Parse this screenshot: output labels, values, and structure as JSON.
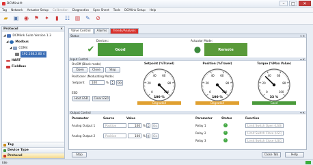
{
  "window": {
    "title": "DCMlink®",
    "min": "–",
    "max": "□",
    "close": "✕"
  },
  "menu": [
    "Tag",
    "Network",
    "Actuator Setup",
    "Calibration",
    "Diagnostics",
    "Spec Sheet",
    "Tools",
    "DCMlink Setup",
    "Help"
  ],
  "toolbar_icons": [
    "folder-icon",
    "device-icon",
    "network-icon",
    "flag-icon",
    "wizard-icon",
    "calibrate-icon",
    "checklist-icon",
    "chart-icon",
    "edit-icon",
    "help-icon"
  ],
  "sidebar": {
    "title": "Protocol",
    "close": "×",
    "tree": [
      {
        "label": "DCMlink Suite Version 1.3"
      },
      {
        "label": "Modbus"
      },
      {
        "label": "COM4"
      },
      {
        "label": "192.168.2.80 4"
      },
      {
        "label": "HART"
      },
      {
        "label": "Fieldbus"
      }
    ],
    "nav": [
      {
        "label": "Tag",
        "color": "#c98a1b"
      },
      {
        "label": "Device Type",
        "color": "#3c8f3c"
      },
      {
        "label": "Protocol",
        "color": "#c73a2a"
      }
    ]
  },
  "tabs": [
    {
      "label": "Valve Control"
    },
    {
      "label": "Alarms"
    },
    {
      "label": "Trends/Analysis"
    }
  ],
  "status_section": {
    "title": "Status",
    "devices_label": "Devices:",
    "devices_value": "Good",
    "mode_label": "Actuator Mode:",
    "mode_value": "Remote",
    "colors": {
      "good": "#4a9a3a",
      "remote": "#5a9a3a"
    }
  },
  "input_control": {
    "title": "Input Control",
    "onoff_label": "On/Off (Block mode)",
    "open": "Open",
    "close": "Close",
    "stop": "Stop",
    "positioner_label": "Positioner (Modulating Mode)",
    "setpoint_label": "Setpoint",
    "setpoint_value": "100",
    "setpoint_unit": "%",
    "go": "Go",
    "esd_label": "ESD",
    "host_esd": "Host ESD",
    "clear_esd": "Clear ESD"
  },
  "gauges": [
    {
      "title": "Setpoint (%Travel)",
      "value_text": "100 %",
      "status": "Degraded",
      "status_color": "#e0a030",
      "ticks": [
        "0",
        "20",
        "40",
        "60",
        "80",
        "100"
      ],
      "value": 100
    },
    {
      "title": "Position (%Travel)",
      "value_text": "100 %",
      "status": "Degraded",
      "status_color": "#e0a030",
      "ticks": [
        "0",
        "20",
        "40",
        "60",
        "80",
        "100"
      ],
      "value": 100
    },
    {
      "title": "Torque (%Max Value)",
      "value_text": "33 %",
      "status": "Good",
      "status_color": "#4a9a3a",
      "ticks": [
        "0",
        "20",
        "40",
        "60",
        "80",
        "100"
      ],
      "value": 33
    }
  ],
  "output_control": {
    "title": "Output Control",
    "headers_left": [
      "Parameter",
      "Source",
      "Value"
    ],
    "headers_right": [
      "Parameter",
      "Status",
      "Function"
    ],
    "rows_left": [
      {
        "param": "Analog Output 1",
        "source": "Position",
        "value": "100",
        "unit": "%",
        "go": "Go"
      },
      {
        "param": "Analog Output 2",
        "source": "Position",
        "value": "100",
        "unit": "%",
        "go": "Go"
      }
    ],
    "rows_right": [
      {
        "param": "Relay 1",
        "function": "Limit Switch Open (LSO)"
      },
      {
        "param": "Relay 2",
        "function": "Limit Switch Close (LSC)"
      },
      {
        "param": "Relay 3",
        "function": "Limit Switch Close (LSC)"
      }
    ]
  },
  "footer": {
    "stop": "Stop",
    "close_tab": "Close Tab",
    "help": "Help"
  },
  "statusbar": {
    "text": "Idle"
  }
}
